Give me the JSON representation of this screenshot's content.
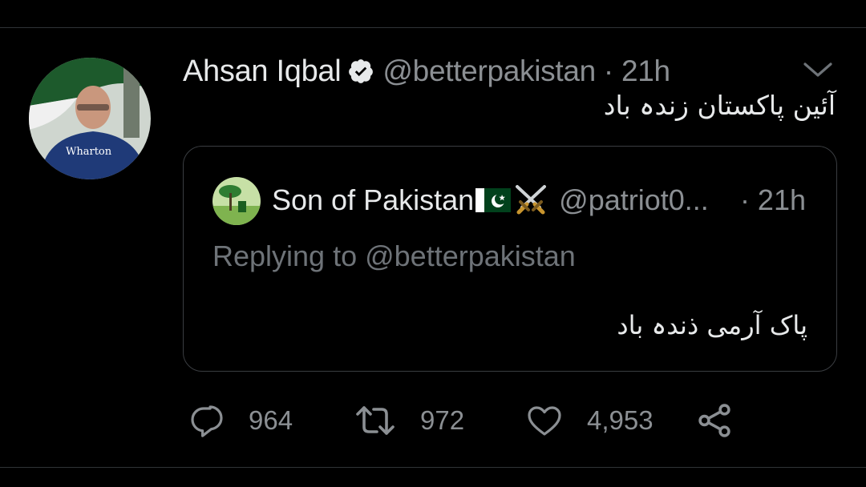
{
  "tweet": {
    "author_name": "Ahsan Iqbal",
    "author_handle": "@betterpakistan",
    "separator": "·",
    "time": "21h",
    "text": "آئین پاکستان زندہ باد",
    "verified": true
  },
  "quote": {
    "author_name": "Son of Pakistan",
    "author_handle": "@patriot0...",
    "time": "· 21h",
    "replying_to": "Replying to @betterpakistan",
    "text": "پاک آرمی ذندہ باد"
  },
  "actions": {
    "replies": "964",
    "retweets": "972",
    "likes": "4,953"
  },
  "colors": {
    "background": "#000000",
    "text_primary": "#e7e9ea",
    "text_secondary": "#8b8f93",
    "divider": "#2f3336",
    "flag_green": "#01411c"
  },
  "icons": [
    "verified-icon",
    "chevron-down-icon",
    "flag-icon",
    "swords-icon",
    "reply-icon",
    "retweet-icon",
    "like-icon",
    "share-icon"
  ]
}
